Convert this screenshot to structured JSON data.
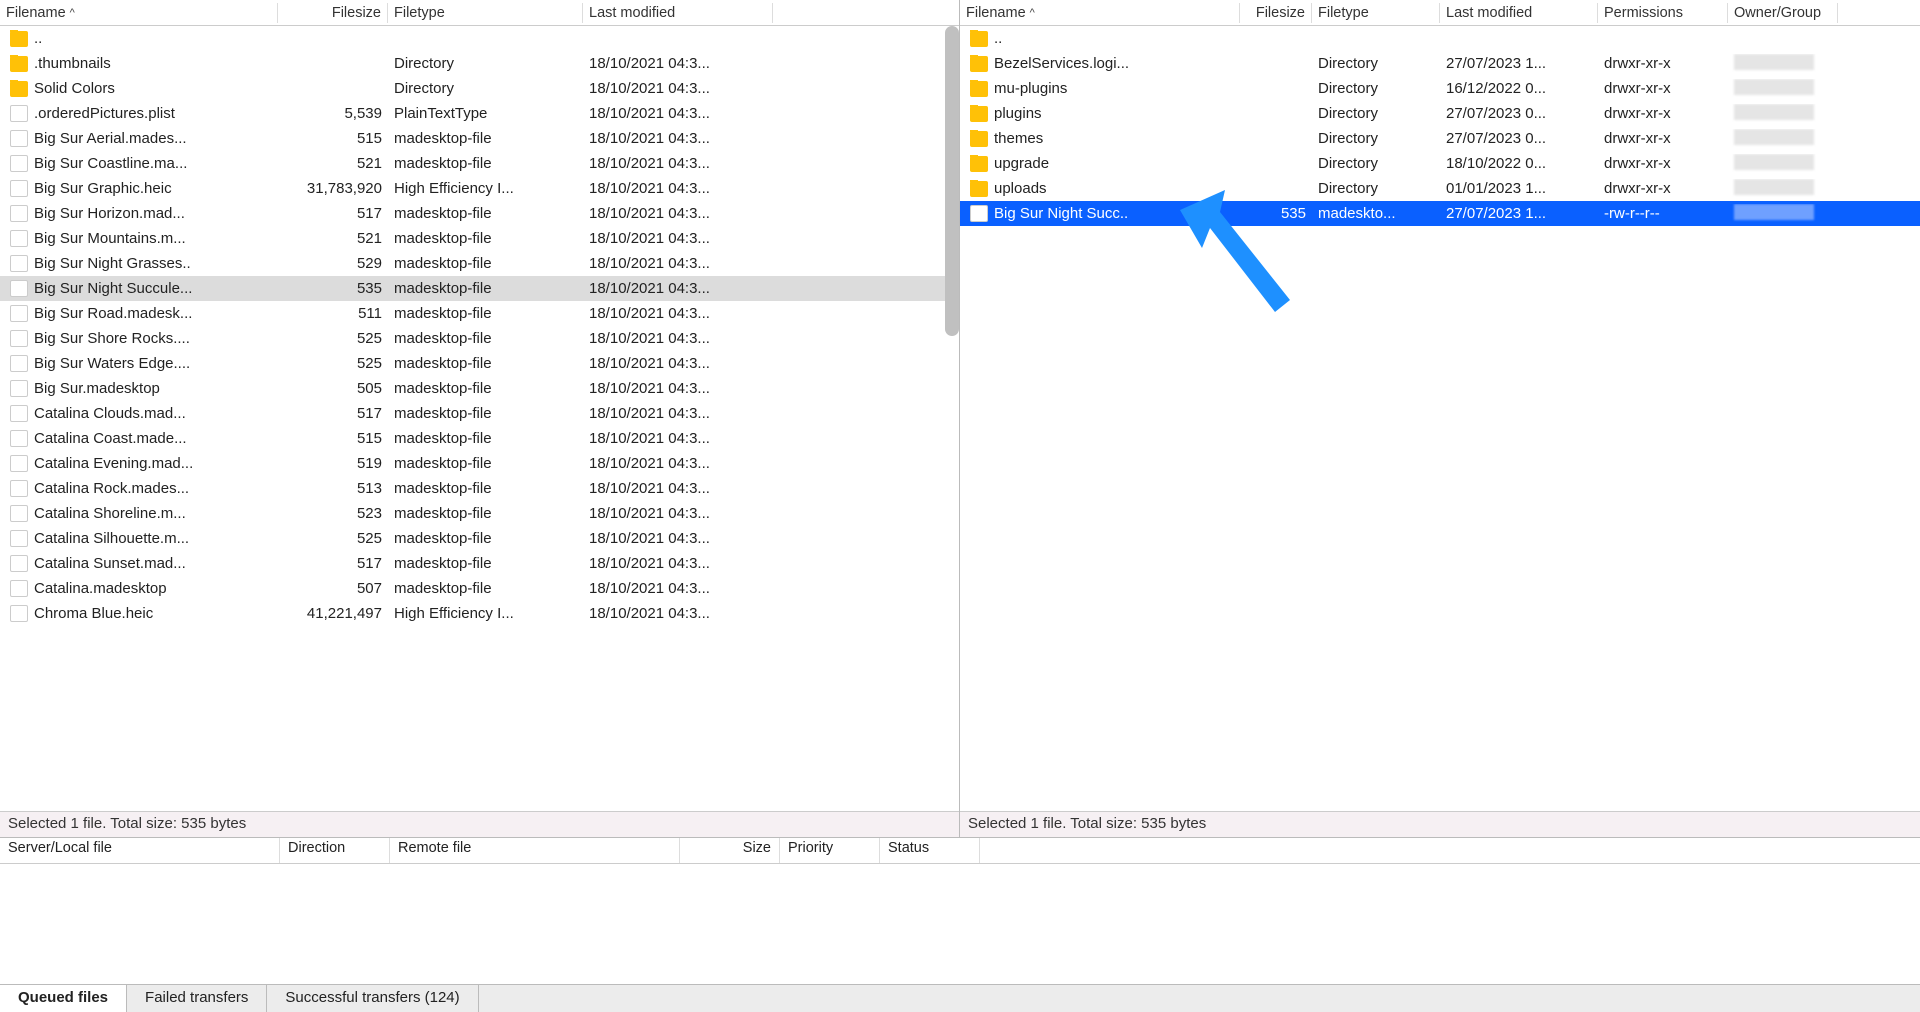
{
  "left": {
    "headers": {
      "filename": "Filename",
      "filesize": "Filesize",
      "filetype": "Filetype",
      "modified": "Last modified"
    },
    "sort_indicator": "^",
    "parent": "..",
    "rows": [
      {
        "icon": "folder",
        "name": ".thumbnails",
        "size": "",
        "type": "Directory",
        "mod": "18/10/2021 04:3..."
      },
      {
        "icon": "folder",
        "name": "Solid Colors",
        "size": "",
        "type": "Directory",
        "mod": "18/10/2021 04:3..."
      },
      {
        "icon": "file",
        "name": ".orderedPictures.plist",
        "size": "5,539",
        "type": "PlainTextType",
        "mod": "18/10/2021 04:3..."
      },
      {
        "icon": "file",
        "name": "Big Sur Aerial.mades...",
        "size": "515",
        "type": "madesktop-file",
        "mod": "18/10/2021 04:3..."
      },
      {
        "icon": "file",
        "name": "Big Sur Coastline.ma...",
        "size": "521",
        "type": "madesktop-file",
        "mod": "18/10/2021 04:3..."
      },
      {
        "icon": "file",
        "name": "Big Sur Graphic.heic",
        "size": "31,783,920",
        "type": "High Efficiency I...",
        "mod": "18/10/2021 04:3..."
      },
      {
        "icon": "file",
        "name": "Big Sur Horizon.mad...",
        "size": "517",
        "type": "madesktop-file",
        "mod": "18/10/2021 04:3..."
      },
      {
        "icon": "file",
        "name": "Big Sur Mountains.m...",
        "size": "521",
        "type": "madesktop-file",
        "mod": "18/10/2021 04:3..."
      },
      {
        "icon": "file",
        "name": "Big Sur Night Grasses..",
        "size": "529",
        "type": "madesktop-file",
        "mod": "18/10/2021 04:3..."
      },
      {
        "icon": "file",
        "name": "Big Sur Night Succule...",
        "size": "535",
        "type": "madesktop-file",
        "mod": "18/10/2021 04:3...",
        "selected": "grey"
      },
      {
        "icon": "file",
        "name": "Big Sur Road.madesk...",
        "size": "511",
        "type": "madesktop-file",
        "mod": "18/10/2021 04:3..."
      },
      {
        "icon": "file",
        "name": "Big Sur Shore Rocks....",
        "size": "525",
        "type": "madesktop-file",
        "mod": "18/10/2021 04:3..."
      },
      {
        "icon": "file",
        "name": "Big Sur Waters Edge....",
        "size": "525",
        "type": "madesktop-file",
        "mod": "18/10/2021 04:3..."
      },
      {
        "icon": "file",
        "name": "Big Sur.madesktop",
        "size": "505",
        "type": "madesktop-file",
        "mod": "18/10/2021 04:3..."
      },
      {
        "icon": "file",
        "name": "Catalina Clouds.mad...",
        "size": "517",
        "type": "madesktop-file",
        "mod": "18/10/2021 04:3..."
      },
      {
        "icon": "file",
        "name": "Catalina Coast.made...",
        "size": "515",
        "type": "madesktop-file",
        "mod": "18/10/2021 04:3..."
      },
      {
        "icon": "file",
        "name": "Catalina Evening.mad...",
        "size": "519",
        "type": "madesktop-file",
        "mod": "18/10/2021 04:3..."
      },
      {
        "icon": "file",
        "name": "Catalina Rock.mades...",
        "size": "513",
        "type": "madesktop-file",
        "mod": "18/10/2021 04:3..."
      },
      {
        "icon": "file",
        "name": "Catalina Shoreline.m...",
        "size": "523",
        "type": "madesktop-file",
        "mod": "18/10/2021 04:3..."
      },
      {
        "icon": "file",
        "name": "Catalina Silhouette.m...",
        "size": "525",
        "type": "madesktop-file",
        "mod": "18/10/2021 04:3..."
      },
      {
        "icon": "file",
        "name": "Catalina Sunset.mad...",
        "size": "517",
        "type": "madesktop-file",
        "mod": "18/10/2021 04:3..."
      },
      {
        "icon": "file",
        "name": "Catalina.madesktop",
        "size": "507",
        "type": "madesktop-file",
        "mod": "18/10/2021 04:3..."
      },
      {
        "icon": "file",
        "name": "Chroma Blue.heic",
        "size": "41,221,497",
        "type": "High Efficiency I...",
        "mod": "18/10/2021 04:3..."
      }
    ],
    "status": "Selected 1 file. Total size: 535 bytes"
  },
  "right": {
    "headers": {
      "filename": "Filename",
      "filesize": "Filesize",
      "filetype": "Filetype",
      "modified": "Last modified",
      "perm": "Permissions",
      "owner": "Owner/Group"
    },
    "sort_indicator": "^",
    "parent": "..",
    "rows": [
      {
        "icon": "folder",
        "name": "BezelServices.logi...",
        "size": "",
        "type": "Directory",
        "mod": "27/07/2023 1...",
        "perm": "drwxr-xr-x",
        "blur": true
      },
      {
        "icon": "folder",
        "name": "mu-plugins",
        "size": "",
        "type": "Directory",
        "mod": "16/12/2022 0...",
        "perm": "drwxr-xr-x",
        "blur": true
      },
      {
        "icon": "folder",
        "name": "plugins",
        "size": "",
        "type": "Directory",
        "mod": "27/07/2023 0...",
        "perm": "drwxr-xr-x",
        "blur": true
      },
      {
        "icon": "folder",
        "name": "themes",
        "size": "",
        "type": "Directory",
        "mod": "27/07/2023 0...",
        "perm": "drwxr-xr-x",
        "blur": true
      },
      {
        "icon": "folder",
        "name": "upgrade",
        "size": "",
        "type": "Directory",
        "mod": "18/10/2022 0...",
        "perm": "drwxr-xr-x",
        "blur": true
      },
      {
        "icon": "folder",
        "name": "uploads",
        "size": "",
        "type": "Directory",
        "mod": "01/01/2023 1...",
        "perm": "drwxr-xr-x",
        "blur": true
      },
      {
        "icon": "file",
        "name": "Big Sur Night Succ..",
        "size": "535",
        "type": "madeskto...",
        "mod": "27/07/2023 1...",
        "perm": "-rw-r--r--",
        "blur": true,
        "selected": "blue"
      }
    ],
    "status": "Selected 1 file. Total size: 535 bytes"
  },
  "queue": {
    "headers": {
      "file": "Server/Local file",
      "direction": "Direction",
      "remote": "Remote file",
      "size": "Size",
      "priority": "Priority",
      "status": "Status"
    }
  },
  "tabs": {
    "queued": "Queued files",
    "failed": "Failed transfers",
    "success": "Successful transfers (124)"
  }
}
